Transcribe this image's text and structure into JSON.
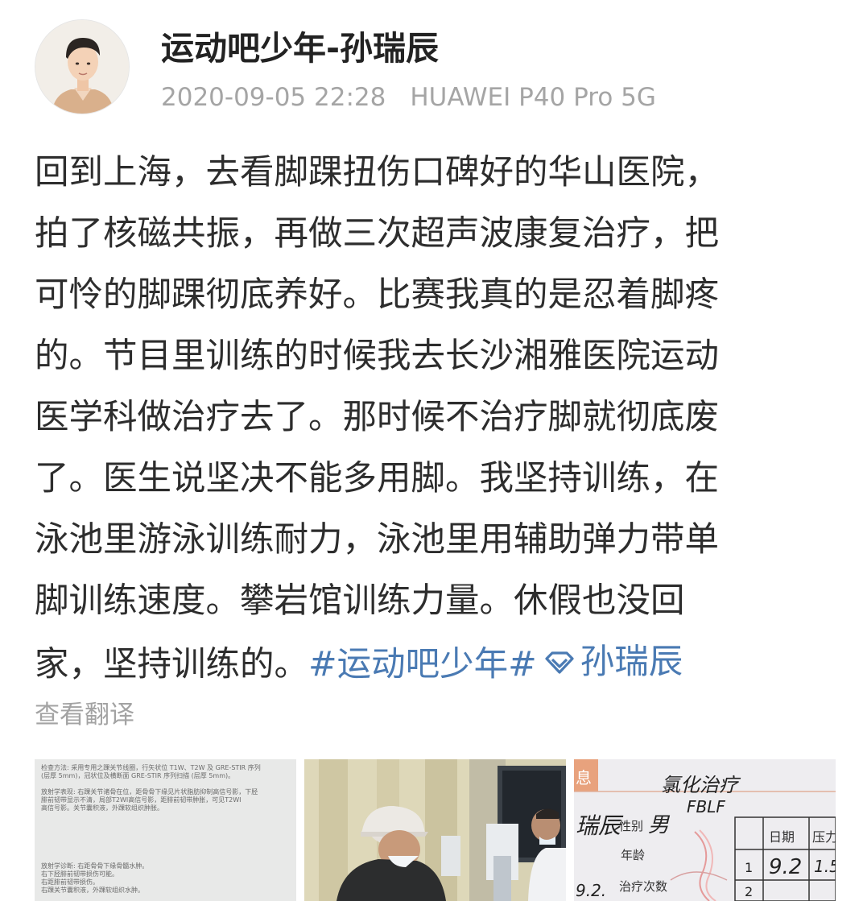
{
  "author": {
    "name": "运动吧少年-孙瑞辰",
    "timestamp": "2020-09-05 22:28",
    "device": "HUAWEI P40 Pro 5G",
    "avatar_icon": "person-portrait"
  },
  "post": {
    "lines": [
      "回到上海，去看脚踝扭伤口碑好的华山医院，",
      "拍了核磁共振，再做三次超声波康复治疗，把",
      "可怜的脚踝彻底养好。比赛我真的是忍着脚疼",
      "的。节目里训练的时候我去长沙湘雅医院运动",
      "医学科做治疗去了。那时候不治疗脚就彻底废",
      "了。医生说坚决不能多用脚。我坚持训练，在",
      "泳池里游泳训练耐力，泳池里用辅助弹力带单",
      "脚训练速度。攀岩馆训练力量。休假也没回"
    ],
    "last_line_text": "家，坚持训练的。",
    "topic": "#运动吧少年#",
    "super_topic": "孙瑞辰",
    "super_topic_icon": "diamond-icon",
    "link_color": "#4a7ab3",
    "text_color": "#2d2d2d"
  },
  "translate_label": "查看翻译",
  "images": [
    {
      "name": "radiology-report",
      "text_rows": [
        "检查方法:   采用专用之踝关节线圈，行矢状位 T1W、T2W 及 GRE-STIR 序列",
        "           (层厚 5mm)，冠状位及横断面 GRE-STIR 序列扫描 (层厚 5mm)。",
        "放射学表现:  右踝关节诸骨在位，距骨骨下缘见片状脂肪抑制高信号影，下胫",
        "           腓前韧带显示不清，局部T2WI高信号影，距腓前韧带肿胀，可见T2WI",
        "           高信号影。关节囊积液，外踝软组织肿胀。",
        "放射学诊断:  右距骨骨下缘骨髓水肿。",
        "           右下胫腓前韧带损伤可能。",
        "           右距腓前韧带损伤。",
        "           右踝关节囊积液，外踝软组织水肿。"
      ]
    },
    {
      "name": "treatment-photo"
    },
    {
      "name": "treatment-record",
      "header_text": "息",
      "handwriting_1": "氯化治疗",
      "handwriting_2": "FBLF",
      "name_field": "瑞辰",
      "gender_label": "性别",
      "gender_value": "男",
      "age_label": "年龄",
      "count_label": "治疗次数",
      "date_label": "日期",
      "pressure_label": "压力",
      "row1_num": "1",
      "row1_date": "9.2",
      "row1_pressure": "1.5",
      "row2_num": "2",
      "left_date": "9.2."
    }
  ]
}
